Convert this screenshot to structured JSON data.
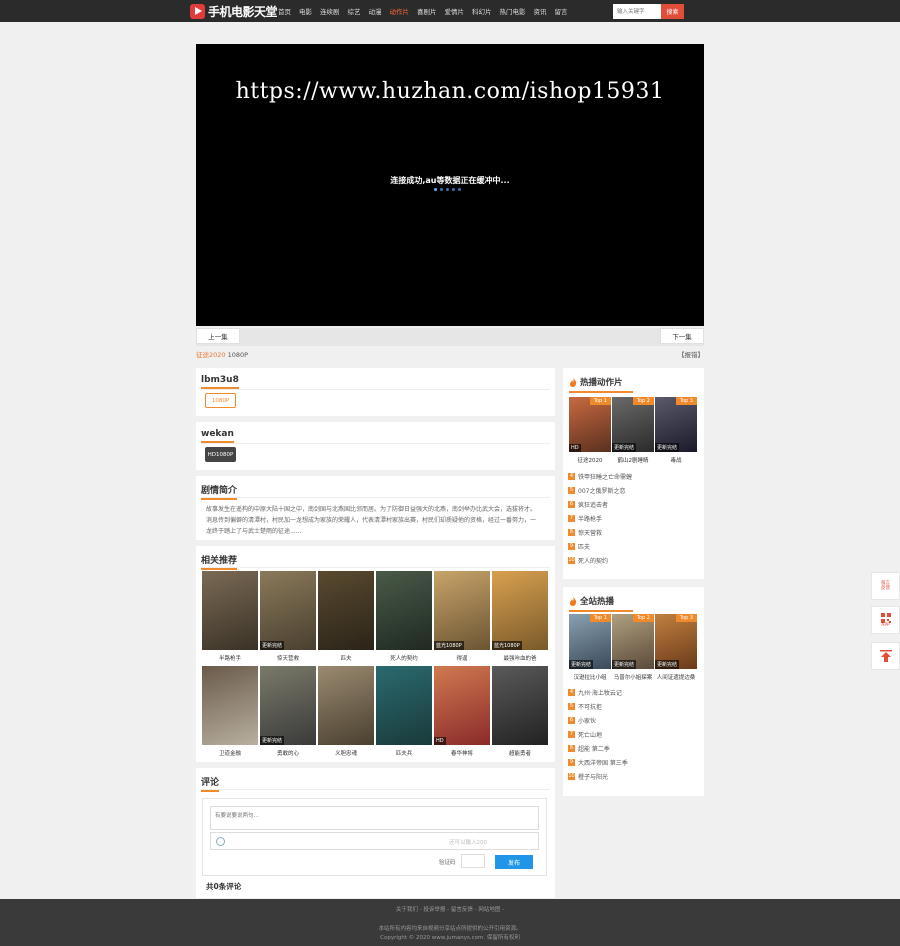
{
  "header": {
    "logo_text": "手机电影天堂",
    "nav": [
      "首页",
      "电影",
      "连续剧",
      "综艺",
      "动漫",
      "动作片",
      "喜剧片",
      "爱情片",
      "科幻片",
      "热门电影",
      "资讯",
      "留言"
    ],
    "active_nav": 5,
    "search_placeholder": "输入关键字",
    "search_button": "搜索"
  },
  "player": {
    "watermark": "https://www.huzhan.com/ishop15931",
    "buffer_text": "连接成功,au等数据正在缓冲中..."
  },
  "episode_bar": {
    "prev": "上一集",
    "next": "下一集"
  },
  "info": {
    "title": "征途2020",
    "quality": "1080P",
    "report": "【报错】"
  },
  "source1": {
    "name": "lbm3u8",
    "tag": "1080P"
  },
  "source2": {
    "name": "wekan",
    "tag": "HD1080P"
  },
  "synopsis": {
    "title": "剧情简介",
    "text": "故事发生在遥构的中原大陆十国之中，南剑国与北燕国比邻而居。为了防御日益强大的北燕，南剑举办比武大会，选拔将才。消息传到偏僻的清潭村，村民加一龙想成为家族的荣耀人，代表清潭村家族出赛，村民们却质疑他的资格，经过一番努力，一龙终于踏上了与武士楚雨的征途......"
  },
  "related": {
    "title": "相关推荐",
    "items": [
      {
        "name": "半路枪手",
        "badge": "",
        "c1": "#3a3226",
        "c2": "#7a6a55"
      },
      {
        "name": "惊天营救",
        "badge": "更新完结",
        "c1": "#4a3f30",
        "c2": "#8a7a5a"
      },
      {
        "name": "匹夫",
        "badge": "",
        "c1": "#2a2418",
        "c2": "#5a4a30"
      },
      {
        "name": "死人的契约",
        "badge": "",
        "c1": "#1f2a22",
        "c2": "#4a5a48"
      },
      {
        "name": "得逞",
        "badge": "蓝光1080P",
        "c1": "#6a5532",
        "c2": "#c9a36a"
      },
      {
        "name": "最强咔血的爸",
        "badge": "蓝光1080P",
        "c1": "#7a5a2a",
        "c2": "#d8a050"
      },
      {
        "name": "卫道金融",
        "badge": "",
        "c1": "#b8b0a0",
        "c2": "#6a5a4a"
      },
      {
        "name": "勇敢的心",
        "badge": "更新完结",
        "c1": "#3a3a3a",
        "c2": "#7a7a6a"
      },
      {
        "name": "义胆忠魂",
        "badge": "",
        "c1": "#4a4030",
        "c2": "#9a8a70"
      },
      {
        "name": "匹夫兵",
        "badge": "",
        "c1": "#1a3a3a",
        "c2": "#2a6a70"
      },
      {
        "name": "春华神将",
        "badge": "HD",
        "c1": "#8a2a2a",
        "c2": "#d07a50"
      },
      {
        "name": "超能勇者",
        "badge": "",
        "c1": "#222222",
        "c2": "#5a5a5a"
      }
    ]
  },
  "comments": {
    "title": "评论",
    "placeholder": "有要说要说两句...",
    "hint": "还可以输入200",
    "vcode_label": "验证码",
    "publish": "发布",
    "count": "共0条评论"
  },
  "hot_action": {
    "title": "热播动作片",
    "top": [
      {
        "rank": "Top 1",
        "name": "征途2020",
        "badge": "HD",
        "c1": "#5a3020",
        "c2": "#c86a40"
      },
      {
        "rank": "Top 2",
        "name": "鹤山2剧睡睛",
        "badge": "更新完结",
        "c1": "#2a2a2a",
        "c2": "#6a6a6a"
      },
      {
        "rank": "Top 3",
        "name": "毒战",
        "badge": "更新完结",
        "c1": "#1a1a2a",
        "c2": "#5a5a6a"
      }
    ],
    "list": [
      {
        "num": "4",
        "name": "铁甲狂睡之亡命需蝗"
      },
      {
        "num": "5",
        "name": "007之俄罗斯之恋"
      },
      {
        "num": "6",
        "name": "疯狂追击者"
      },
      {
        "num": "7",
        "name": "半路枪手"
      },
      {
        "num": "8",
        "name": "惊天营救"
      },
      {
        "num": "9",
        "name": "匹夫"
      },
      {
        "num": "10",
        "name": "死人的契约"
      }
    ]
  },
  "hot_all": {
    "title": "全站热播",
    "top": [
      {
        "rank": "Top 1",
        "name": "汉逊拉比小组",
        "badge": "更新完结",
        "c1": "#3a4a5a",
        "c2": "#8aa0b0"
      },
      {
        "rank": "Top 2",
        "name": "马普尔小姐探案",
        "badge": "更新完结",
        "c1": "#5a4a3a",
        "c2": "#b0a080"
      },
      {
        "rank": "Top 3",
        "name": "人间证遗提边桑",
        "badge": "更新完结",
        "c1": "#6a3a1a",
        "c2": "#c08040"
      }
    ],
    "list": [
      {
        "num": "4",
        "name": "九州·海上牧云记"
      },
      {
        "num": "5",
        "name": "不可抗拒"
      },
      {
        "num": "6",
        "name": "小家伙"
      },
      {
        "num": "7",
        "name": "死亡山地"
      },
      {
        "num": "8",
        "name": "超能 第二季"
      },
      {
        "num": "9",
        "name": "大西洋帝国 第三季"
      },
      {
        "num": "10",
        "name": "橙子与阳光"
      }
    ]
  },
  "float": {
    "report": "留言\n反馈",
    "app": "APP"
  },
  "footer": {
    "links": "关于我们 - 投诉举报 - 留言反馈 - 网站地图 -",
    "line2": "本站所有内容均来自视频分享站点所提供的公开引用资源。",
    "line3": "Copyright © 2020 www.jumanys.com. 保留所有权利"
  }
}
